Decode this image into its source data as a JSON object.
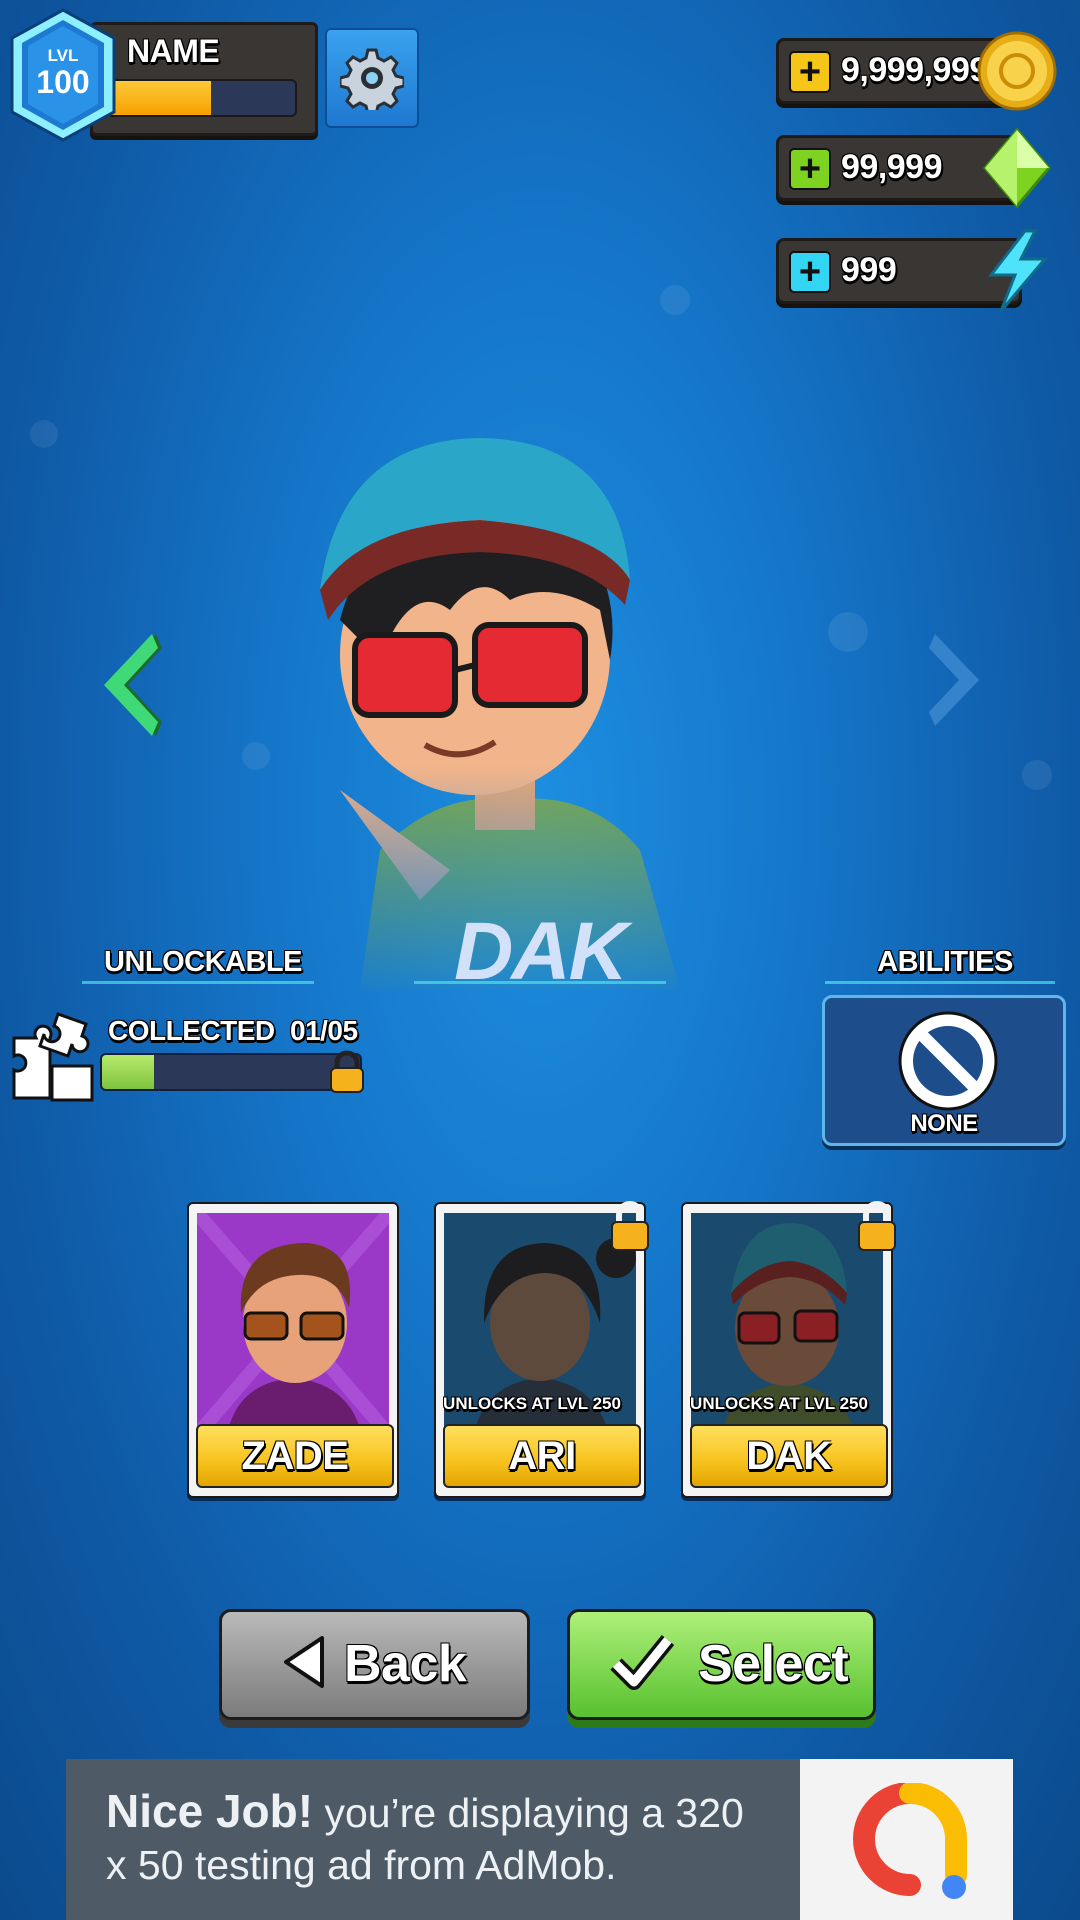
{
  "profile": {
    "level_prefix": "LVL",
    "level": "100",
    "name": "NAME",
    "xp_fraction": 0.55
  },
  "currencies": [
    {
      "name": "coins",
      "amount": "9,999,999",
      "icon": "gold-coin-icon",
      "color": "#f5c518"
    },
    {
      "name": "gems",
      "amount": "99,999",
      "icon": "green-gem-icon",
      "color": "#7ed321"
    },
    {
      "name": "energy",
      "amount": "999",
      "icon": "lightning-bolt-icon",
      "color": "#33d6f2"
    }
  ],
  "character": {
    "name": "DAK"
  },
  "unlockable": {
    "label": "UNLOCKABLE",
    "collected_label": "COLLECTED",
    "collected_count": "01/05",
    "progress_fraction": 0.2
  },
  "abilities": {
    "label": "ABILITIES",
    "value": "NONE"
  },
  "cards": [
    {
      "name": "ZADE",
      "locked": false,
      "unlock_text": ""
    },
    {
      "name": "ARI",
      "locked": true,
      "unlock_text": "UNLOCKS AT LVL 250"
    },
    {
      "name": "DAK",
      "locked": true,
      "unlock_text": "UNLOCKS AT LVL 250"
    }
  ],
  "buttons": {
    "back": "Back",
    "select": "Select"
  },
  "ad": {
    "headline": "Nice Job!",
    "body": "you’re displaying a 320 x 50 testing ad from AdMob."
  },
  "colors": {
    "accent_green": "#58c12f",
    "accent_yellow": "#f7c21d",
    "cyan_line": "#4de1e8"
  }
}
